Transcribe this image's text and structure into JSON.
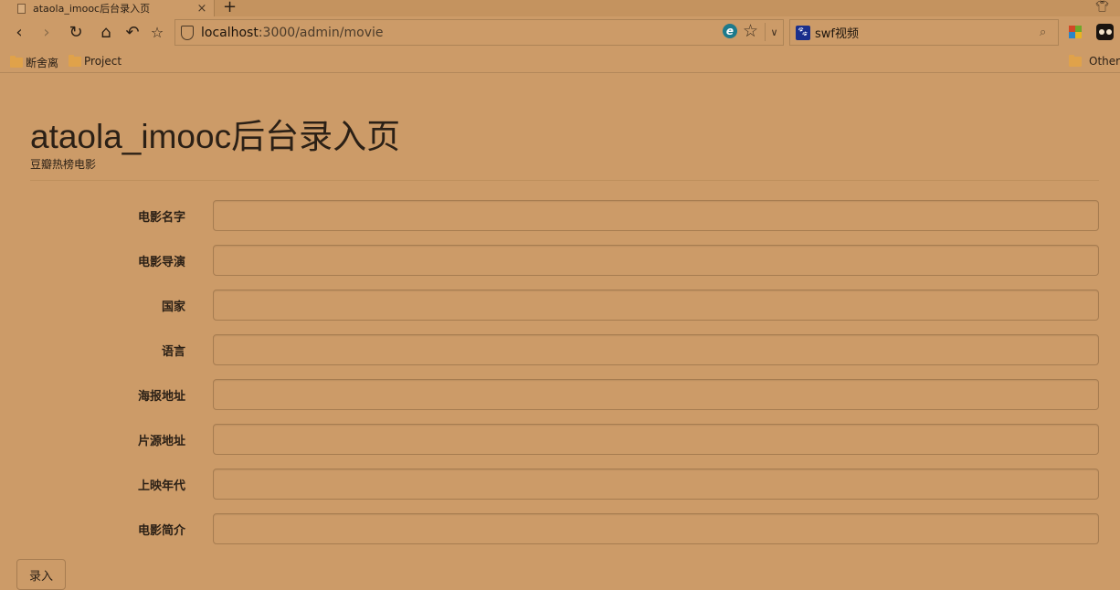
{
  "browser": {
    "tab_title": "ataola_imooc后台录入页",
    "tab_close": "×",
    "new_tab": "+",
    "url_host": "localhost",
    "url_path": ":3000/admin/movie",
    "search_text": "swf视频",
    "bookmarks": [
      "断舍离",
      "Project"
    ],
    "other_bookmarks": "Other"
  },
  "page": {
    "title": "ataola_imooc后台录入页",
    "subtitle": "豆瓣热榜电影"
  },
  "form": {
    "fields": [
      {
        "label": "电影名字",
        "value": ""
      },
      {
        "label": "电影导演",
        "value": ""
      },
      {
        "label": "国家",
        "value": ""
      },
      {
        "label": "语言",
        "value": ""
      },
      {
        "label": "海报地址",
        "value": ""
      },
      {
        "label": "片源地址",
        "value": ""
      },
      {
        "label": "上映年代",
        "value": ""
      },
      {
        "label": "电影简介",
        "value": ""
      }
    ],
    "submit_label": "录入"
  },
  "icons": {
    "back": "back-arrow-icon",
    "forward": "forward-arrow-icon",
    "reload": "reload-icon",
    "home": "home-icon",
    "undo": "undo-icon",
    "favorite": "star-icon"
  }
}
